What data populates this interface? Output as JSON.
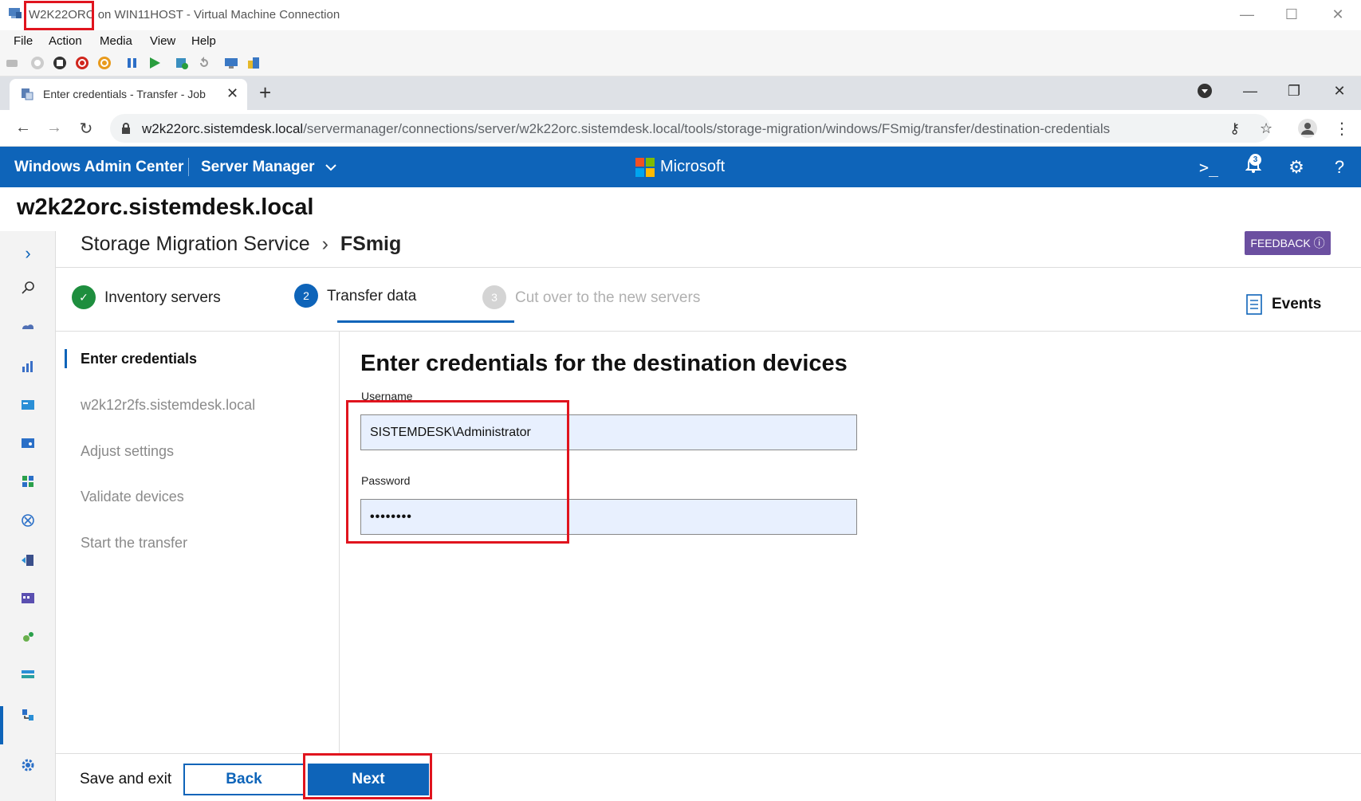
{
  "vm_window": {
    "title": "W2K22ORC on WIN11HOST - Virtual Machine Connection",
    "menu": [
      "File",
      "Action",
      "Media",
      "View",
      "Help"
    ],
    "controls": {
      "minimize": "—",
      "maximize": "☐",
      "close": "✕"
    }
  },
  "browser": {
    "tab_title": "Enter credentials - Transfer - Job",
    "tab_close": "✕",
    "new_tab": "+",
    "url_host": "w2k22orc.sistemdesk.local",
    "url_path": "/servermanager/connections/server/w2k22orc.sistemdesk.local/tools/storage-migration/windows/FSmig/transfer/destination-credentials",
    "icons": {
      "back": "←",
      "forward": "→",
      "reload": "↻",
      "key": "⚷",
      "star": "☆",
      "menu": "⋮"
    }
  },
  "wac_header": {
    "brand": "Windows Admin Center",
    "tool": "Server Manager",
    "microsoft": "Microsoft",
    "notification_count": "3"
  },
  "server_name": "w2k22orc.sistemdesk.local",
  "breadcrumb": {
    "parent": "Storage Migration Service",
    "separator": "›",
    "current": "FSmig"
  },
  "feedback_label": "FEEDBACK ⓘ",
  "steps": [
    {
      "number": "✓",
      "label": "Inventory servers",
      "state": "done"
    },
    {
      "number": "2",
      "label": "Transfer data",
      "state": "active"
    },
    {
      "number": "3",
      "label": "Cut over to the new servers",
      "state": "pending"
    }
  ],
  "events_label": "Events",
  "subnav": [
    {
      "label": "Enter credentials",
      "active": true
    },
    {
      "label": "w2k12r2fs.sistemdesk.local",
      "active": false
    },
    {
      "label": "Adjust settings",
      "active": false
    },
    {
      "label": "Validate devices",
      "active": false
    },
    {
      "label": "Start the transfer",
      "active": false
    }
  ],
  "form": {
    "title": "Enter credentials for the destination devices",
    "username_label": "Username",
    "username_value": "SISTEMDESK\\Administrator",
    "password_label": "Password",
    "password_value": "••••••••"
  },
  "footer": {
    "save_exit": "Save and exit",
    "back": "Back",
    "next": "Next"
  },
  "colors": {
    "accent": "#0e64b9",
    "highlight": "#e0141e",
    "feedback": "#6b4fa0",
    "success": "#1e8e3e"
  }
}
